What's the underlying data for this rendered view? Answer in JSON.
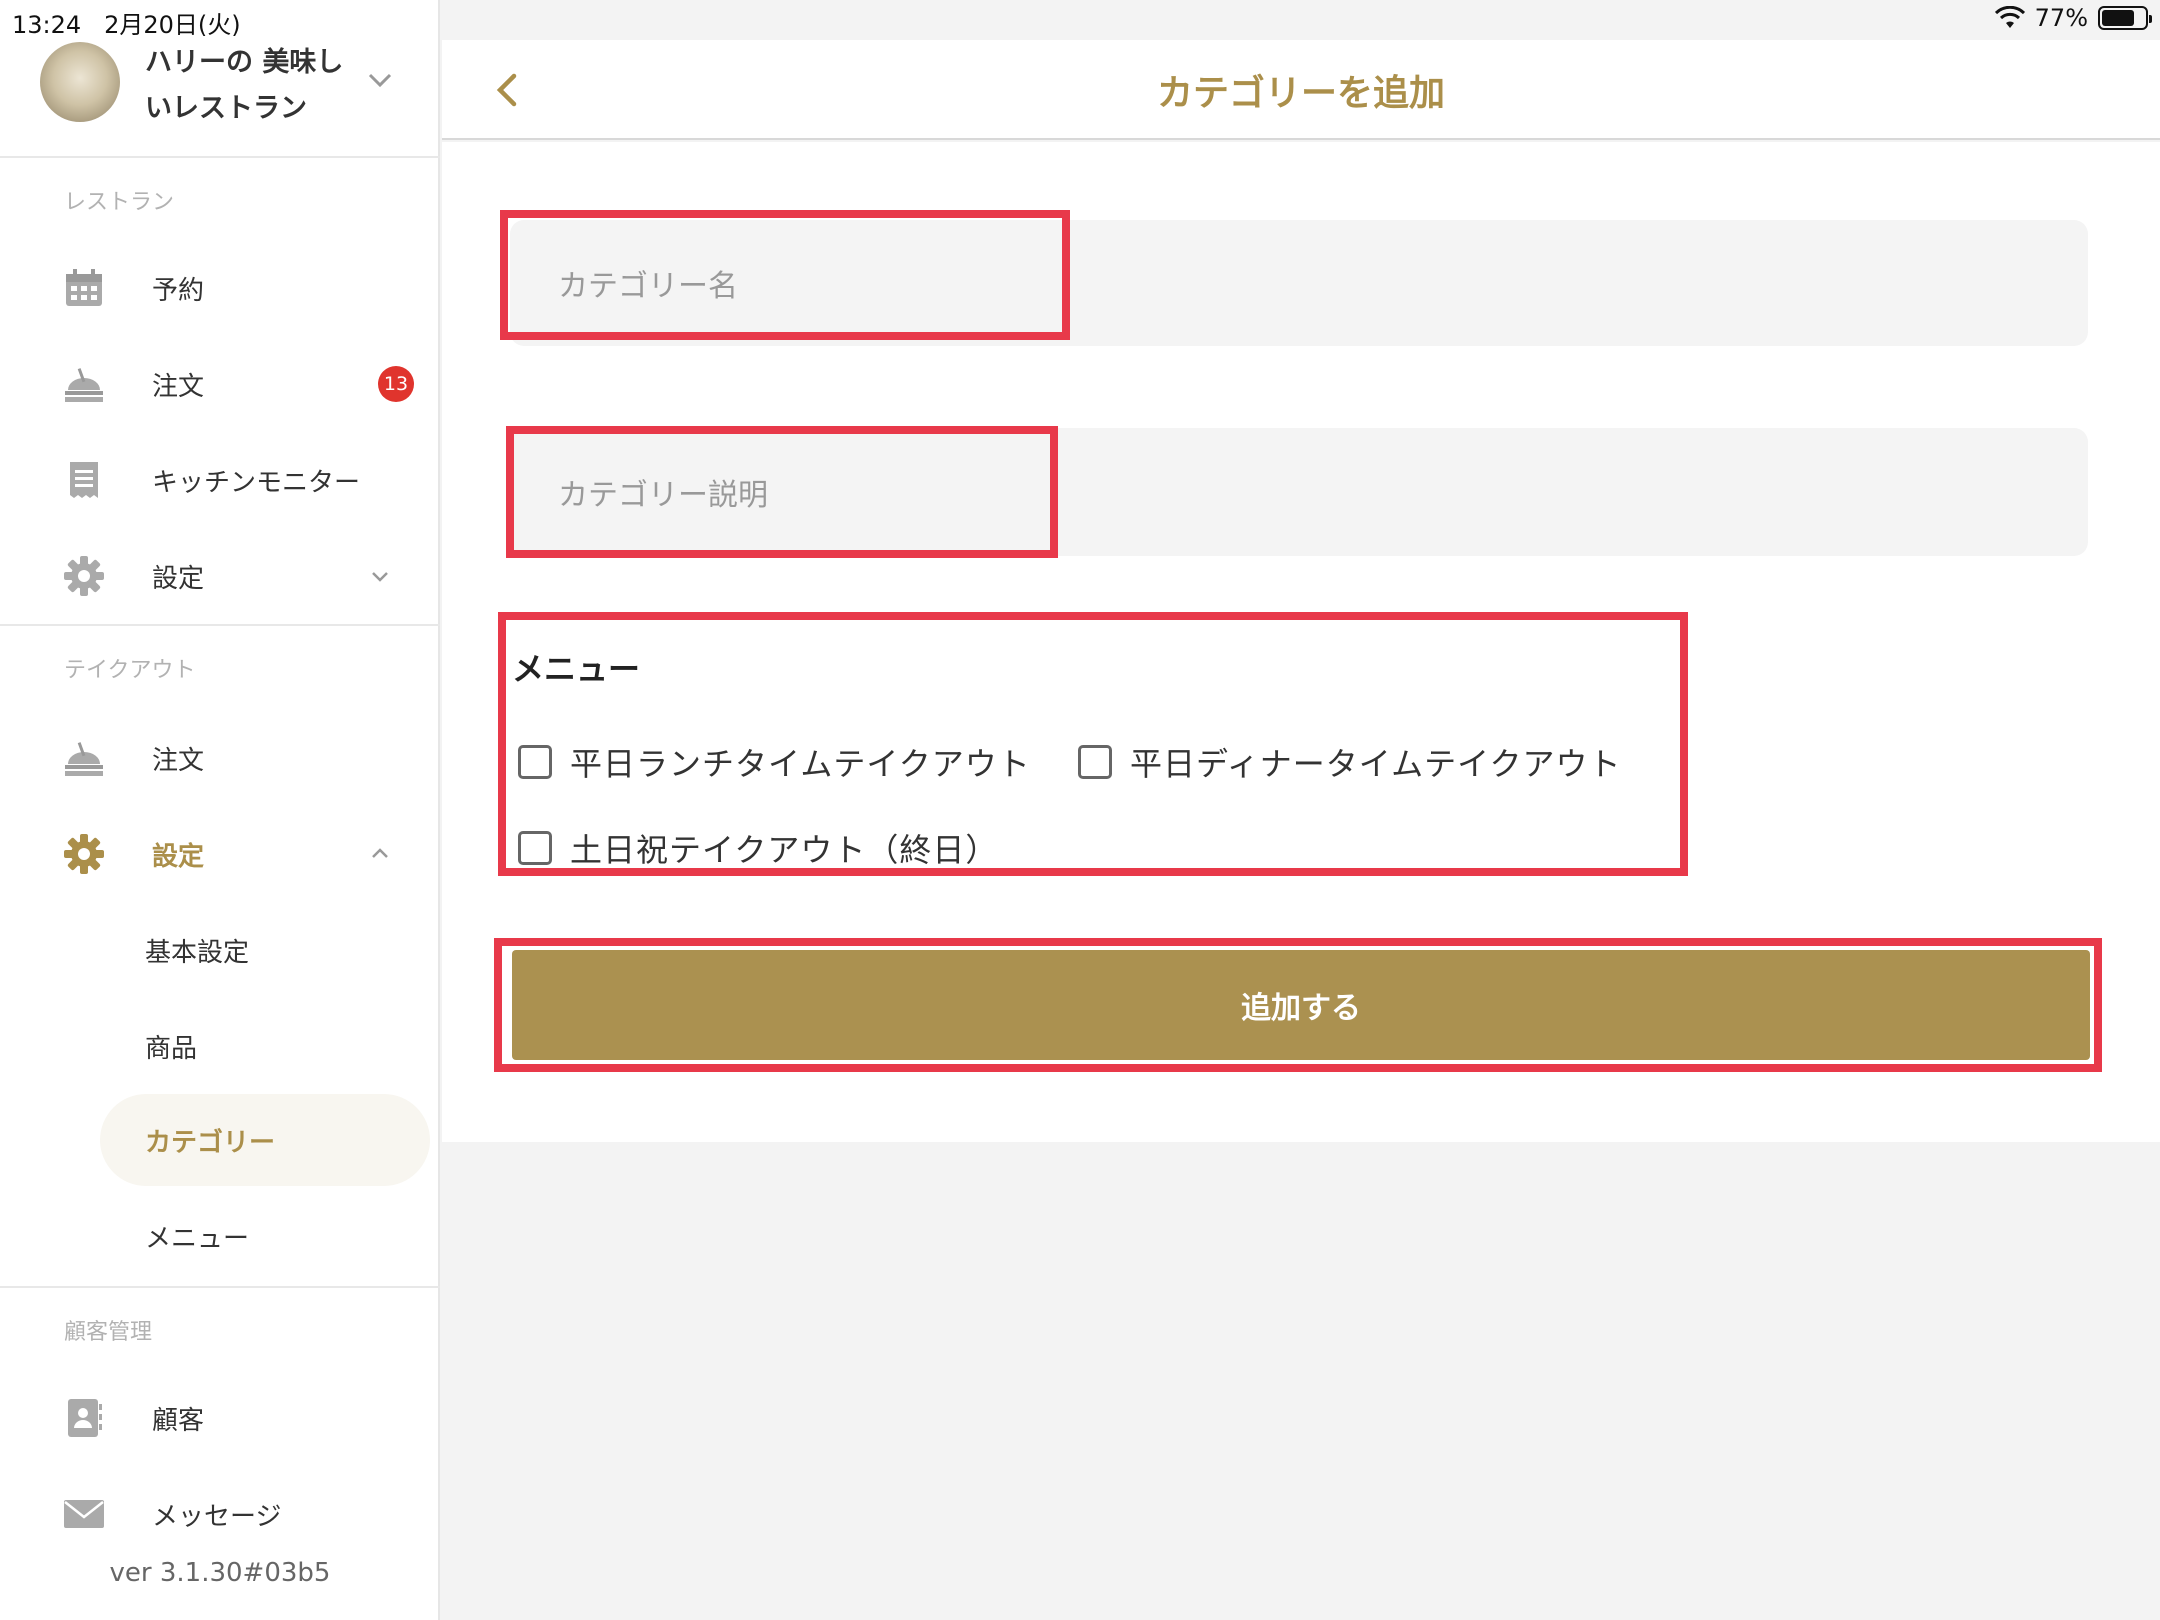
{
  "status_bar": {
    "time": "13:24",
    "date": "2月20日(火)",
    "battery_percent": "77%",
    "battery_level": 0.77
  },
  "profile": {
    "name": "ハリーの 美味しいレストラン"
  },
  "sidebar": {
    "sections": [
      {
        "label": "レストラン",
        "items": [
          {
            "label": "予約",
            "icon": "calendar-icon"
          },
          {
            "label": "注文",
            "icon": "food-tray-icon",
            "badge": "13"
          },
          {
            "label": "キッチンモニター",
            "icon": "receipt-icon"
          },
          {
            "label": "設定",
            "icon": "gear-icon",
            "expanded": false
          }
        ]
      },
      {
        "label": "テイクアウト",
        "items": [
          {
            "label": "注文",
            "icon": "food-tray-icon"
          },
          {
            "label": "設定",
            "icon": "gear-icon",
            "expanded": true,
            "active": true
          }
        ],
        "subitems": [
          {
            "label": "基本設定"
          },
          {
            "label": "商品"
          },
          {
            "label": "カテゴリー",
            "active": true
          },
          {
            "label": "メニュー"
          }
        ]
      },
      {
        "label": "顧客管理",
        "items": [
          {
            "label": "顧客",
            "icon": "contact-card-icon"
          },
          {
            "label": "メッセージ",
            "icon": "envelope-icon"
          }
        ]
      }
    ],
    "version": "ver 3.1.30#03b5"
  },
  "header": {
    "title": "カテゴリーを追加"
  },
  "form": {
    "name_placeholder": "カテゴリー名",
    "description_placeholder": "カテゴリー説明",
    "menu_heading": "メニュー",
    "menu_options": [
      {
        "label": "平日ランチタイムテイクアウト",
        "checked": false
      },
      {
        "label": "平日ディナータイムテイクアウト",
        "checked": false
      },
      {
        "label": "土日祝テイクアウト（終日）",
        "checked": false
      }
    ],
    "submit_label": "追加する"
  },
  "colors": {
    "accent": "#ab8f4a",
    "button": "#ab9150",
    "badge": "#e0342d",
    "highlight": "#e8394a"
  }
}
